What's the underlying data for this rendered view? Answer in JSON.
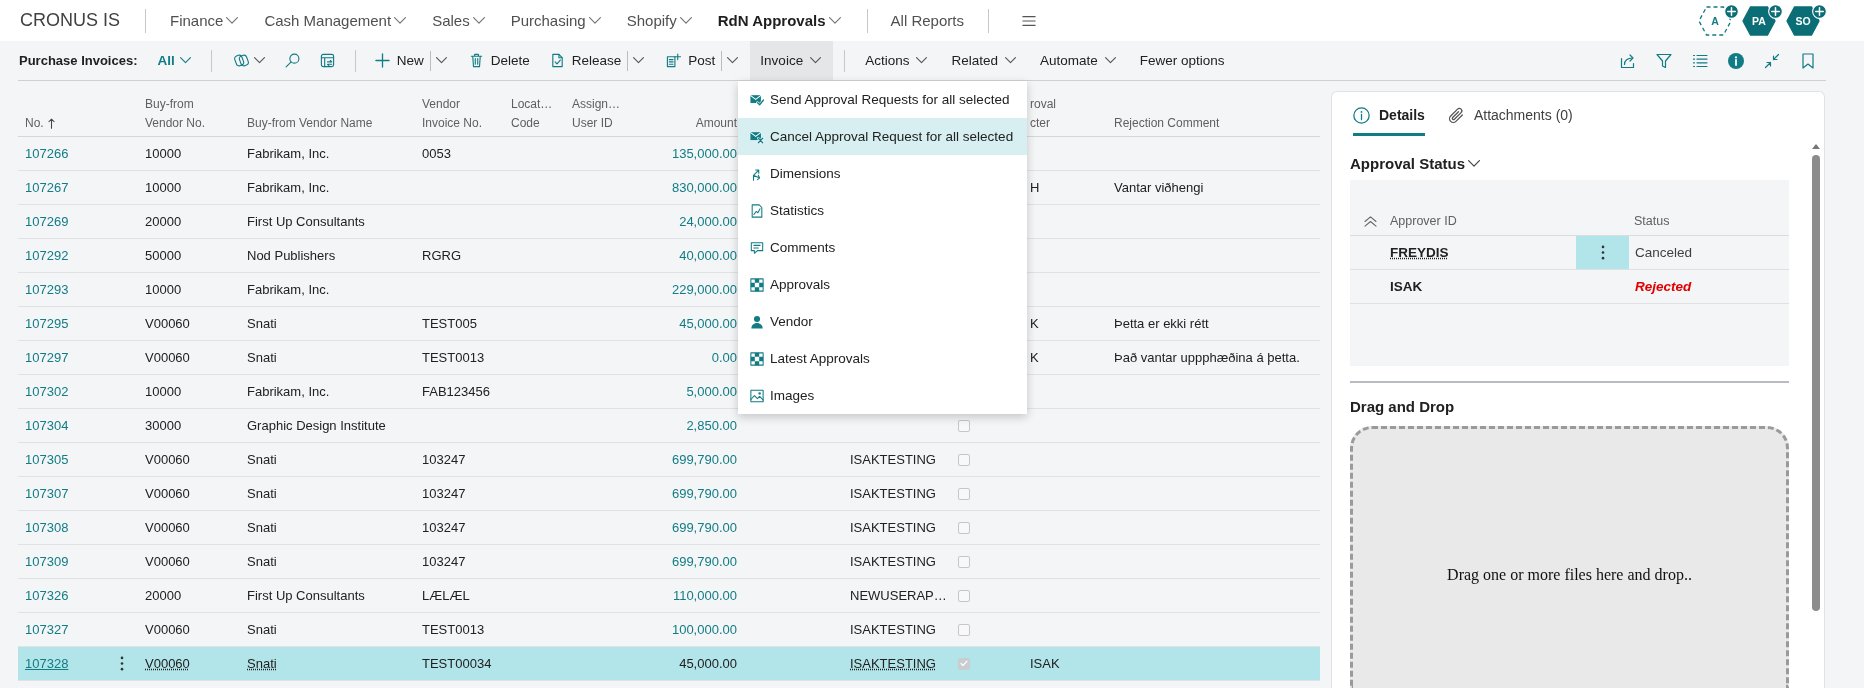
{
  "app": {
    "company": "CRONUS IS"
  },
  "nav": {
    "menus": [
      {
        "label": "Finance",
        "selected": false
      },
      {
        "label": "Cash Management",
        "selected": false
      },
      {
        "label": "Sales",
        "selected": false
      },
      {
        "label": "Purchasing",
        "selected": false
      },
      {
        "label": "Shopify",
        "selected": false
      },
      {
        "label": "RdN Approvals",
        "selected": true
      }
    ],
    "link": "All Reports"
  },
  "users": [
    {
      "initials": "A",
      "active": false
    },
    {
      "initials": "PA",
      "active": true
    },
    {
      "initials": "SO",
      "active": true
    }
  ],
  "action_bar": {
    "page_title": "Purchase Invoices:",
    "view": "All",
    "actions": [
      {
        "label": "New",
        "kind": "new",
        "open": false
      },
      {
        "label": "Delete",
        "kind": "delete",
        "open": false
      },
      {
        "label": "Release",
        "kind": "release",
        "open": false
      },
      {
        "label": "Post",
        "kind": "post",
        "open": false
      },
      {
        "label": "Invoice",
        "kind": "menu",
        "open": true
      }
    ],
    "more_actions": [
      {
        "label": "Actions",
        "kind": "menu",
        "open": false
      },
      {
        "label": "Related",
        "kind": "menu",
        "open": false
      },
      {
        "label": "Automate",
        "kind": "menu",
        "open": false
      },
      {
        "label": "Fewer options",
        "kind": "plain",
        "open": false
      }
    ]
  },
  "invoice_menu": {
    "items": [
      {
        "label": "Send Approval Requests for all selected",
        "kind": "send",
        "selected": false
      },
      {
        "label": "Cancel Approval Request for all selected",
        "kind": "cancel",
        "selected": true
      },
      {
        "label": "Dimensions",
        "kind": "dimensions",
        "selected": false
      },
      {
        "label": "Statistics",
        "kind": "statistics",
        "selected": false
      },
      {
        "label": "Comments",
        "kind": "comments",
        "selected": false
      },
      {
        "label": "Approvals",
        "kind": "approvals",
        "selected": false
      },
      {
        "label": "Vendor",
        "kind": "vendor",
        "selected": false
      },
      {
        "label": "Latest Approvals",
        "kind": "latest",
        "selected": false
      },
      {
        "label": "Images",
        "kind": "images",
        "selected": false
      }
    ]
  },
  "table": {
    "headers": {
      "no": {
        "label": "No.",
        "sorted": true
      },
      "buy_from_vendor_no": {
        "label": "Buy-from\nVendor No.",
        "sorted": false
      },
      "buy_from_vendor_name": {
        "label": "Buy-from Vendor Name",
        "sorted": false
      },
      "vendor_invoice_no": {
        "label": "Vendor\nInvoice No.",
        "sorted": false
      },
      "location_code": {
        "label": "Locat…\nCode",
        "sorted": false
      },
      "assigned_user_id": {
        "label": "Assign…\nUser ID",
        "sorted": false
      },
      "amount": {
        "label": "Amount",
        "sorted": false
      },
      "column_11": {
        "label": "roval\ncter",
        "sorted": false
      },
      "rejection_comment": {
        "label": "Rejection Comment",
        "sorted": false
      }
    },
    "rows": [
      {
        "no": "107266",
        "buy_from_vendor_no": "10000",
        "buy_from_vendor_name": "Fabrikam, Inc.",
        "vendor_invoice_no": "0053",
        "amount": "135,000.00",
        "selected": false
      },
      {
        "no": "107267",
        "buy_from_vendor_no": "10000",
        "buy_from_vendor_name": "Fabrikam, Inc.",
        "amount": "830,000.00",
        "column_11": "H",
        "rejection_comment": "Vantar viðhengi",
        "selected": false
      },
      {
        "no": "107269",
        "buy_from_vendor_no": "20000",
        "buy_from_vendor_name": "First Up Consultants",
        "amount": "24,000.00",
        "selected": false
      },
      {
        "no": "107292",
        "buy_from_vendor_no": "50000",
        "buy_from_vendor_name": "Nod Publishers",
        "vendor_invoice_no": "RGRG",
        "amount": "40,000.00",
        "selected": false
      },
      {
        "no": "107293",
        "buy_from_vendor_no": "10000",
        "buy_from_vendor_name": "Fabrikam, Inc.",
        "amount": "229,000.00",
        "selected": false
      },
      {
        "no": "107295",
        "buy_from_vendor_no": "V00060",
        "buy_from_vendor_name": "Snati",
        "vendor_invoice_no": "TEST005",
        "amount": "45,000.00",
        "column_11": "K",
        "rejection_comment": "Þetta er ekki rétt",
        "selected": false
      },
      {
        "no": "107297",
        "buy_from_vendor_no": "V00060",
        "buy_from_vendor_name": "Snati",
        "vendor_invoice_no": "TEST0013",
        "amount": "0.00",
        "column_11": "K",
        "rejection_comment": "Það vantar uppphæðina á þetta.",
        "selected": false
      },
      {
        "no": "107302",
        "buy_from_vendor_no": "10000",
        "buy_from_vendor_name": "Fabrikam, Inc.",
        "vendor_invoice_no": "FAB123456",
        "amount": "5,000.00",
        "selected": false
      },
      {
        "no": "107304",
        "buy_from_vendor_no": "30000",
        "buy_from_vendor_name": "Graphic Design Institute",
        "amount": "2,850.00",
        "checked": false,
        "selected": false
      },
      {
        "no": "107305",
        "buy_from_vendor_no": "V00060",
        "buy_from_vendor_name": "Snati",
        "vendor_invoice_no": "103247",
        "amount": "699,790.00",
        "column_9": "ISAKTESTING",
        "checked": false,
        "selected": false
      },
      {
        "no": "107307",
        "buy_from_vendor_no": "V00060",
        "buy_from_vendor_name": "Snati",
        "vendor_invoice_no": "103247",
        "amount": "699,790.00",
        "column_9": "ISAKTESTING",
        "checked": false,
        "selected": false
      },
      {
        "no": "107308",
        "buy_from_vendor_no": "V00060",
        "buy_from_vendor_name": "Snati",
        "vendor_invoice_no": "103247",
        "amount": "699,790.00",
        "column_9": "ISAKTESTING",
        "checked": false,
        "selected": false
      },
      {
        "no": "107309",
        "buy_from_vendor_no": "V00060",
        "buy_from_vendor_name": "Snati",
        "vendor_invoice_no": "103247",
        "amount": "699,790.00",
        "column_9": "ISAKTESTING",
        "checked": false,
        "selected": false
      },
      {
        "no": "107326",
        "buy_from_vendor_no": "20000",
        "buy_from_vendor_name": "First Up Consultants",
        "vendor_invoice_no": "LÆLÆL",
        "amount": "110,000.00",
        "column_9": "NEWUSERAP…",
        "checked": false,
        "selected": false
      },
      {
        "no": "107327",
        "buy_from_vendor_no": "V00060",
        "buy_from_vendor_name": "Snati",
        "vendor_invoice_no": "TEST0013",
        "amount": "100,000.00",
        "column_9": "ISAKTESTING",
        "checked": false,
        "selected": false
      },
      {
        "no": "107328",
        "buy_from_vendor_no": "V00060",
        "buy_from_vendor_name": "Snati",
        "vendor_invoice_no": "TEST00034",
        "amount": "45,000.00",
        "column_9": "ISAKTESTING",
        "checked": true,
        "column_11": "ISAK",
        "selected": true
      }
    ]
  },
  "factbox": {
    "tabs": [
      {
        "label": "Details",
        "selected": true
      },
      {
        "label": "Attachments (0)",
        "selected": false
      }
    ],
    "approval_status": {
      "title": "Approval Status",
      "expanded": true,
      "headers": {
        "approver_id": "Approver ID",
        "status": "Status"
      },
      "rows": [
        {
          "approver_id": "FREYDIS",
          "status": "Canceled",
          "kind": "standard",
          "selected": true
        },
        {
          "approver_id": "ISAK",
          "status": "Rejected",
          "kind": "unfavorable",
          "selected": false
        }
      ]
    },
    "drag_and_drop": {
      "title": "Drag and Drop",
      "hint": "Drag one or more files here and drop.."
    }
  }
}
